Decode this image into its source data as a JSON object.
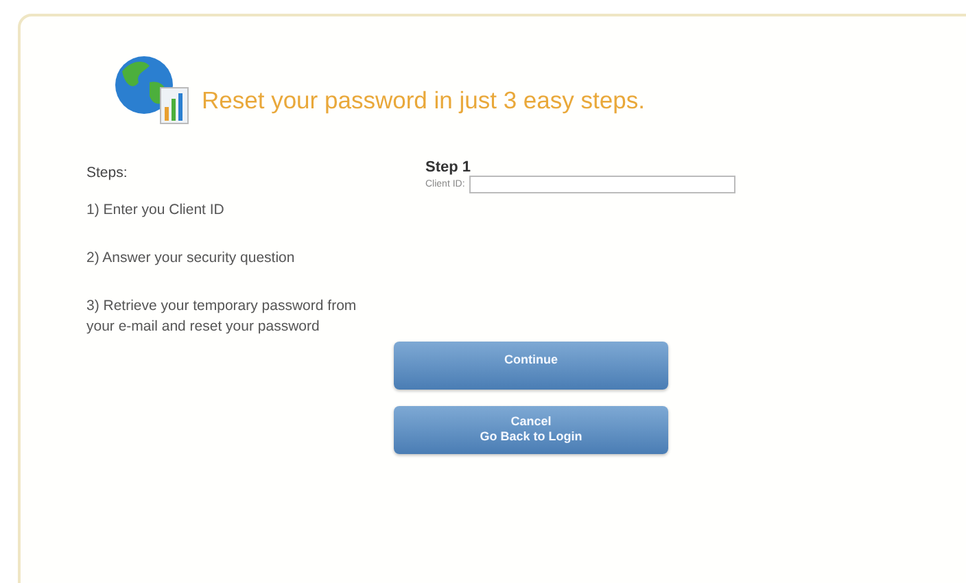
{
  "header": {
    "title": "Reset your password in just 3 easy steps."
  },
  "steps": {
    "heading": "Steps:",
    "items": [
      "1) Enter you Client ID",
      "2) Answer your security question",
      "3) Retrieve your temporary password from your e-mail and reset your password"
    ]
  },
  "form": {
    "heading": "Step 1",
    "field_label": "Client ID:"
  },
  "buttons": [
    {
      "kind": "continue",
      "lines": [
        "Continue"
      ]
    },
    {
      "kind": "cancel",
      "lines": [
        "Cancel",
        "Go Back to Login"
      ]
    }
  ]
}
